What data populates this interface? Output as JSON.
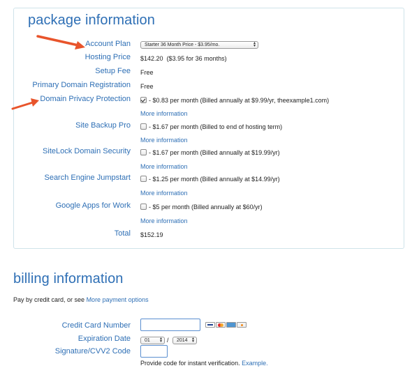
{
  "package": {
    "title": "package information",
    "account_plan": {
      "label": "Account Plan",
      "selected": "Starter 36 Month Price - $3.95/mo."
    },
    "hosting_price": {
      "label": "Hosting Price",
      "amount": "$142.20",
      "detail": "($3.95 for 36 months)"
    },
    "setup_fee": {
      "label": "Setup Fee",
      "value": "Free"
    },
    "primary_domain": {
      "label": "Primary Domain Registration",
      "value": "Free"
    },
    "addons": [
      {
        "label": "Domain Privacy Protection",
        "checked": true,
        "text": "- $0.83 per month (Billed annually at $9.99/yr, theexample1.com)",
        "more": "More information"
      },
      {
        "label": "Site Backup Pro",
        "checked": false,
        "text": "- $1.67 per month (Billed to end of hosting term)",
        "more": "More information"
      },
      {
        "label": "SiteLock Domain Security",
        "checked": false,
        "text": "- $1.67 per month (Billed annually at $19.99/yr)",
        "more": "More information"
      },
      {
        "label": "Search Engine Jumpstart",
        "checked": false,
        "text": "- $1.25 per month (Billed annually at $14.99/yr)",
        "more": "More information"
      },
      {
        "label": "Google Apps for Work",
        "checked": false,
        "text": "- $5 per month (Billed annually at $60/yr)",
        "more": "More information"
      }
    ],
    "total": {
      "label": "Total",
      "value": "$152.19"
    }
  },
  "billing": {
    "title": "billing information",
    "intro_text": "Pay by credit card, or see",
    "intro_link": "More payment options",
    "card_number_label": "Credit Card Number",
    "card_number_value": "",
    "expiration_label": "Expiration Date",
    "exp_month": "01",
    "exp_sep": "/",
    "exp_year": "2014",
    "cvv_label": "Signature/CVV2 Code",
    "cvv_value": "",
    "cvv_help_text": "Provide code for instant verification.",
    "cvv_help_link": "Example."
  },
  "colors": {
    "accent": "#2e6fb5",
    "annotation_arrow": "#e8542b",
    "panel_border": "#cfe3ea"
  },
  "icons": {
    "card_logos": [
      "visa-icon",
      "mastercard-icon",
      "amex-icon",
      "discover-icon"
    ],
    "annotation": "arrow-icon"
  }
}
